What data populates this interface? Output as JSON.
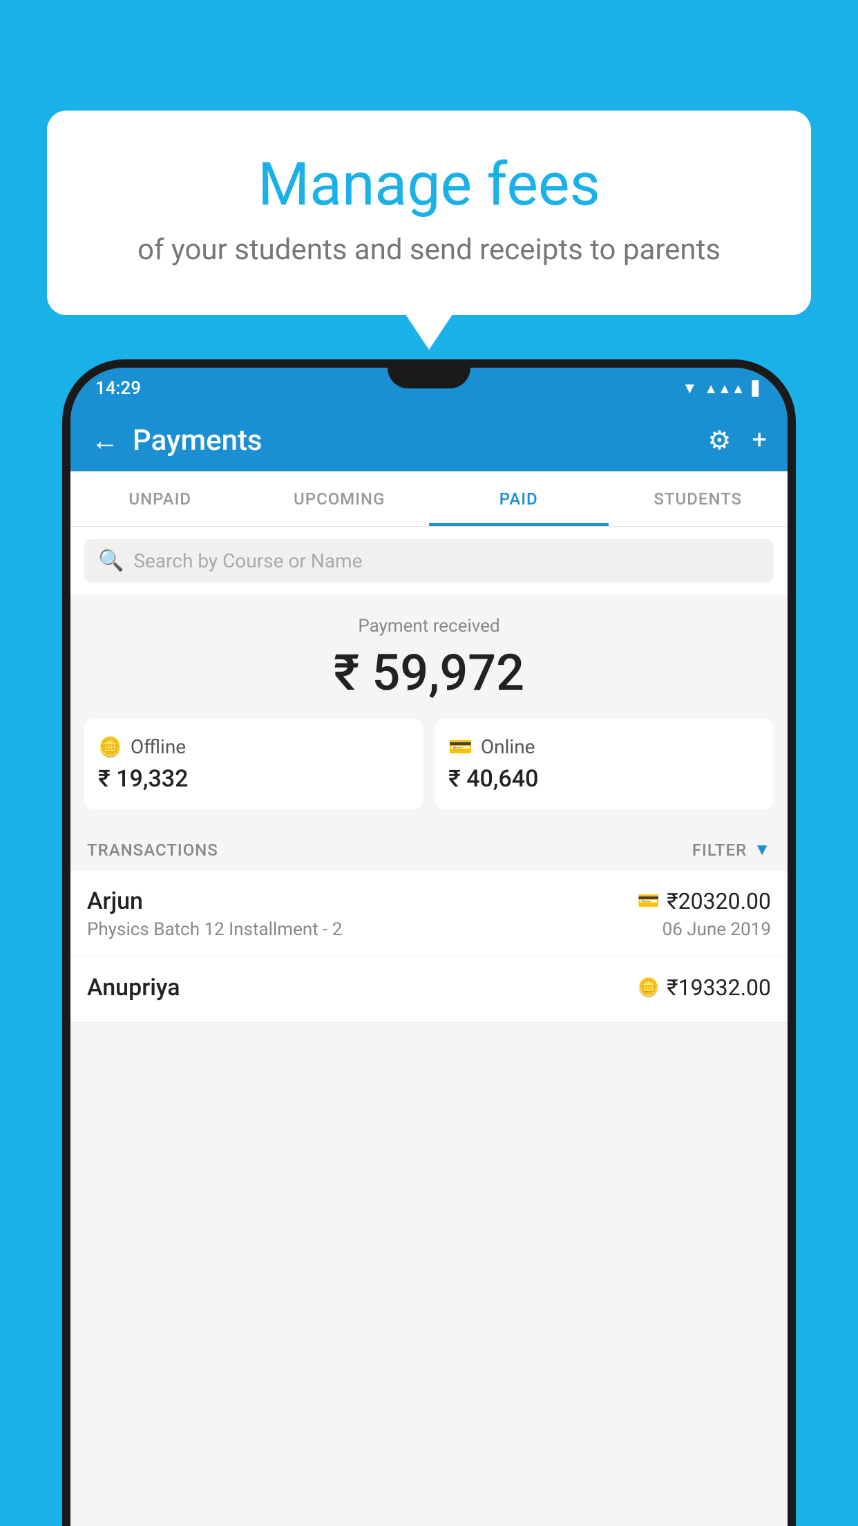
{
  "background_color": "#1ab0e8",
  "bubble": {
    "title": "Manage fees",
    "subtitle": "of your students and send receipts to parents"
  },
  "status_bar": {
    "time": "14:29"
  },
  "app_bar": {
    "title": "Payments",
    "back_label": "←",
    "gear_label": "⚙",
    "plus_label": "+"
  },
  "tabs": [
    {
      "label": "UNPAID",
      "active": false
    },
    {
      "label": "UPCOMING",
      "active": false
    },
    {
      "label": "PAID",
      "active": true
    },
    {
      "label": "STUDENTS",
      "active": false
    }
  ],
  "search": {
    "placeholder": "Search by Course or Name"
  },
  "payment_received": {
    "label": "Payment received",
    "total": "₹ 59,972",
    "offline": {
      "icon": "💳",
      "label": "Offline",
      "amount": "₹ 19,332"
    },
    "online": {
      "icon": "💳",
      "label": "Online",
      "amount": "₹ 40,640"
    }
  },
  "transactions": {
    "header_label": "TRANSACTIONS",
    "filter_label": "FILTER",
    "rows": [
      {
        "name": "Arjun",
        "amount": "₹20320.00",
        "description": "Physics Batch 12 Installment - 2",
        "date": "06 June 2019",
        "type_icon": "💳"
      },
      {
        "name": "Anupriya",
        "amount": "₹19332.00",
        "description": "",
        "date": "",
        "type_icon": "💴"
      }
    ]
  }
}
